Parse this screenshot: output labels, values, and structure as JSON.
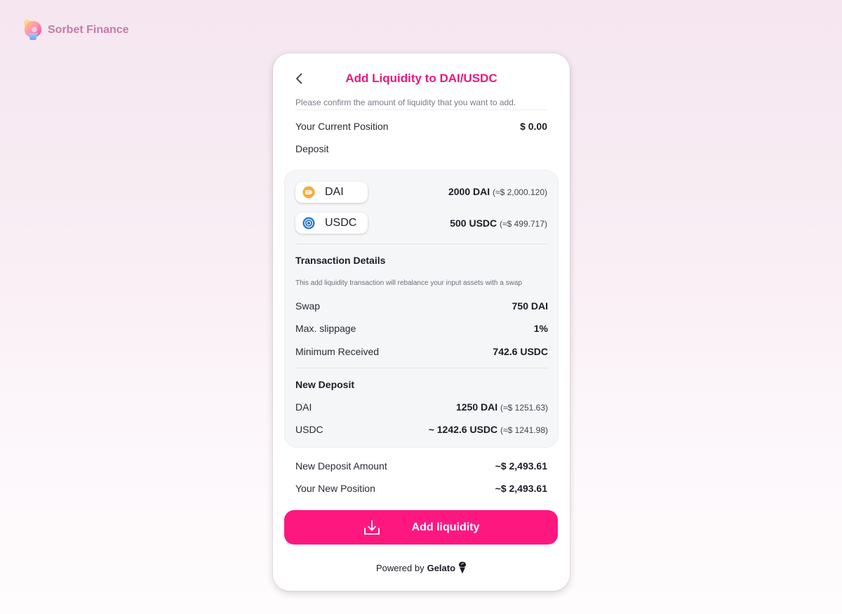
{
  "brand": {
    "name": "Sorbet Finance",
    "icon": "sorbet-logo-icon"
  },
  "header": {
    "title": "Add Liquidity to DAI/USDC",
    "subtitle": "Please confirm the amount of liquidity that you want to add.",
    "back_icon": "chevron-left-icon"
  },
  "position": {
    "label": "Your Current Position",
    "value": "$ 0.00"
  },
  "deposit_label": "Deposit",
  "tokens": [
    {
      "symbol": "DAI",
      "icon": "dai-token-icon",
      "amount": "2000 DAI",
      "approx": "(≈$ 2,000.120)",
      "color": "#f5ac37"
    },
    {
      "symbol": "USDC",
      "icon": "usdc-token-icon",
      "amount": "500 USDC",
      "approx": "(≈$ 499.717)",
      "color": "#2775ca"
    }
  ],
  "transaction": {
    "title": "Transaction Details",
    "note": "This add liquidity transaction will rebalance your input assets with a swap",
    "rows": [
      {
        "label": "Swap",
        "value": "750 DAI"
      },
      {
        "label": "Max. slippage",
        "value": "1%"
      },
      {
        "label": "Minimum Received",
        "value": "742.6 USDC"
      }
    ]
  },
  "new_deposit": {
    "title": "New Deposit",
    "rows": [
      {
        "label": "DAI",
        "value": "1250 DAI",
        "approx": "(≈$ 1251.63)"
      },
      {
        "label": "USDC",
        "value": "~ 1242.6 USDC",
        "approx": "(≈$ 1241.98)"
      }
    ]
  },
  "summary": [
    {
      "label": "New Deposit Amount",
      "value": "~$ 2,493.61"
    },
    {
      "label": "Your New Position",
      "value": "~$ 2,493.61"
    }
  ],
  "cta": {
    "label": "Add liquidity",
    "icon": "download-icon",
    "color": "#ff1780"
  },
  "footer": {
    "powered_by": "Powered by",
    "provider": "Gelato",
    "icon": "gelato-icon"
  },
  "colors": {
    "accent": "#e8187e",
    "brand_text": "#c77aa8"
  }
}
